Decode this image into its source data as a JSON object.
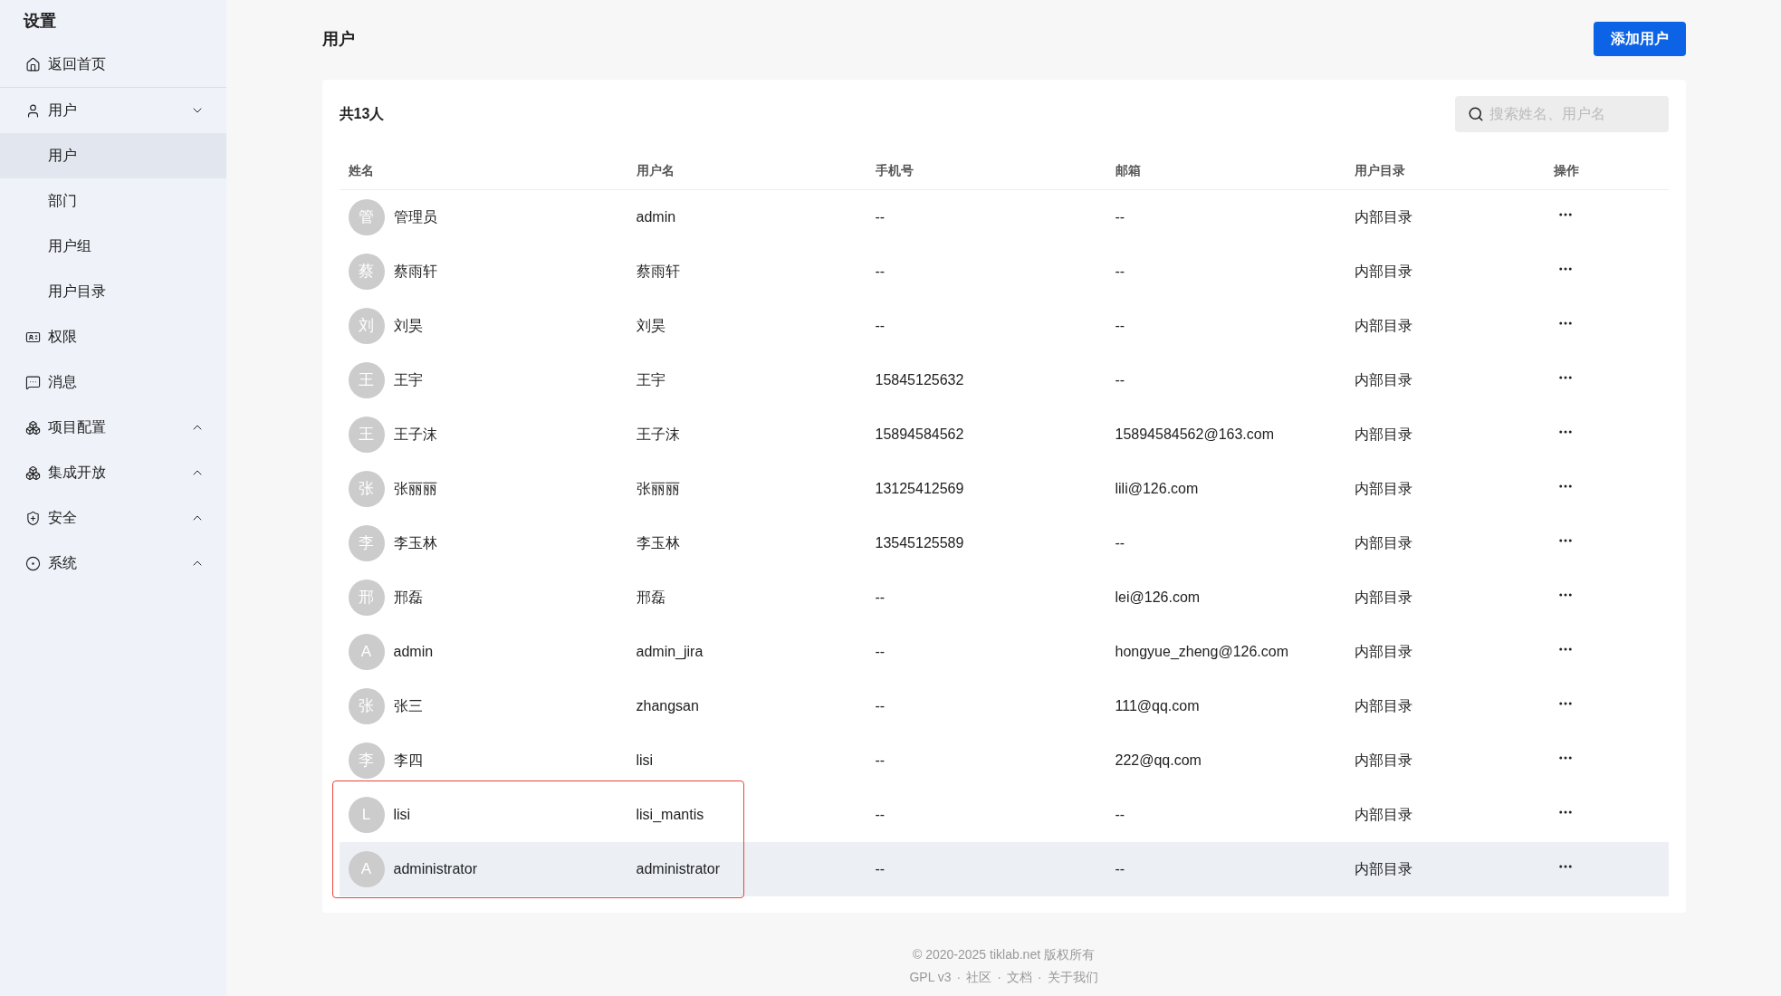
{
  "sidebar": {
    "title": "设置",
    "items": [
      {
        "label": "返回首页",
        "selected": false
      },
      {
        "label": "用户",
        "selected": false,
        "expanded": true,
        "children": [
          {
            "label": "用户",
            "selected": true
          },
          {
            "label": "部门",
            "selected": false
          },
          {
            "label": "用户组",
            "selected": false
          },
          {
            "label": "用户目录",
            "selected": false
          }
        ]
      },
      {
        "label": "权限",
        "selected": false
      },
      {
        "label": "消息",
        "selected": false
      },
      {
        "label": "项目配置",
        "selected": false,
        "expanded": false
      },
      {
        "label": "集成开放",
        "selected": false,
        "expanded": false
      },
      {
        "label": "安全",
        "selected": false,
        "expanded": false
      },
      {
        "label": "系统",
        "selected": false,
        "expanded": false
      }
    ]
  },
  "page": {
    "title": "用户",
    "add_button": "添加用户"
  },
  "card": {
    "count": "共13人",
    "search": {
      "placeholder": "搜索姓名、用户名"
    }
  },
  "table": {
    "columns": [
      "姓名",
      "用户名",
      "手机号",
      "邮箱",
      "用户目录",
      "操作"
    ],
    "rows": [
      {
        "avatar": "管",
        "name": "管理员",
        "username": "admin",
        "phone": "--",
        "email": "--",
        "directory": "内部目录",
        "highlighted": false,
        "outlined": false
      },
      {
        "avatar": "蔡",
        "name": "蔡雨轩",
        "username": "蔡雨轩",
        "phone": "--",
        "email": "--",
        "directory": "内部目录",
        "highlighted": false,
        "outlined": false
      },
      {
        "avatar": "刘",
        "name": "刘昊",
        "username": "刘昊",
        "phone": "--",
        "email": "--",
        "directory": "内部目录",
        "highlighted": false,
        "outlined": false
      },
      {
        "avatar": "王",
        "name": "王宇",
        "username": "王宇",
        "phone": "15845125632",
        "email": "--",
        "directory": "内部目录",
        "highlighted": false,
        "outlined": false
      },
      {
        "avatar": "王",
        "name": "王子沫",
        "username": "王子沫",
        "phone": "15894584562",
        "email": "15894584562@163.com",
        "directory": "内部目录",
        "highlighted": false,
        "outlined": false
      },
      {
        "avatar": "张",
        "name": "张丽丽",
        "username": "张丽丽",
        "phone": "13125412569",
        "email": "lili@126.com",
        "directory": "内部目录",
        "highlighted": false,
        "outlined": false
      },
      {
        "avatar": "李",
        "name": "李玉林",
        "username": "李玉林",
        "phone": "13545125589",
        "email": "--",
        "directory": "内部目录",
        "highlighted": false,
        "outlined": false
      },
      {
        "avatar": "邢",
        "name": "邢磊",
        "username": "邢磊",
        "phone": "--",
        "email": "lei@126.com",
        "directory": "内部目录",
        "highlighted": false,
        "outlined": false
      },
      {
        "avatar": "A",
        "name": "admin",
        "username": "admin_jira",
        "phone": "--",
        "email": "hongyue_zheng@126.com",
        "directory": "内部目录",
        "highlighted": false,
        "outlined": false
      },
      {
        "avatar": "张",
        "name": "张三",
        "username": "zhangsan",
        "phone": "--",
        "email": "111@qq.com",
        "directory": "内部目录",
        "highlighted": false,
        "outlined": false
      },
      {
        "avatar": "李",
        "name": "李四",
        "username": "lisi",
        "phone": "--",
        "email": "222@qq.com",
        "directory": "内部目录",
        "highlighted": false,
        "outlined": false
      },
      {
        "avatar": "L",
        "name": "lisi",
        "username": "lisi_mantis",
        "phone": "--",
        "email": "--",
        "directory": "内部目录",
        "highlighted": false,
        "outlined": true
      },
      {
        "avatar": "A",
        "name": "administrator",
        "username": "administrator",
        "phone": "--",
        "email": "--",
        "directory": "内部目录",
        "highlighted": true,
        "outlined": true
      }
    ]
  },
  "footer": {
    "copyright": "© 2020-2025 tiklab.net 版权所有",
    "links": [
      "GPL v3",
      "社区",
      "文档",
      "关于我们"
    ],
    "separator": "·"
  }
}
